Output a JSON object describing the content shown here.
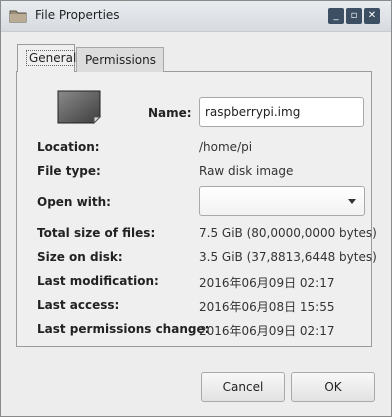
{
  "window": {
    "title": "File Properties",
    "buttons": {
      "minimize": "_",
      "maximize": "▫",
      "close": "✕"
    }
  },
  "tabs": [
    {
      "label": "General",
      "active": true
    },
    {
      "label": "Permissions",
      "active": false
    }
  ],
  "general": {
    "name_label": "Name:",
    "name_value": "raspberrypi.img",
    "fields": [
      {
        "label": "Location:",
        "value": "/home/pi"
      },
      {
        "label": "File type:",
        "value": "Raw disk image"
      },
      {
        "label": "Open with:",
        "value": ""
      },
      {
        "label": "Total size of files:",
        "value": "7.5 GiB (80,0000,0000 bytes)"
      },
      {
        "label": "Size on disk:",
        "value": "3.5 GiB (37,8813,6448 bytes)"
      },
      {
        "label": "Last modification:",
        "value": "2016年06月09日 02:17"
      },
      {
        "label": "Last access:",
        "value": "2016年06月08日 15:55"
      },
      {
        "label": "Last permissions change:",
        "value": "2016年06月09日 02:17"
      }
    ]
  },
  "buttons": {
    "cancel": "Cancel",
    "ok": "OK"
  },
  "icons": {
    "folder": "folder-icon",
    "file": "disk-image-icon",
    "dropdown": "chevron-down-icon"
  },
  "colors": {
    "window_buttons": "#3d4f63",
    "window_bg": "#ededed"
  }
}
